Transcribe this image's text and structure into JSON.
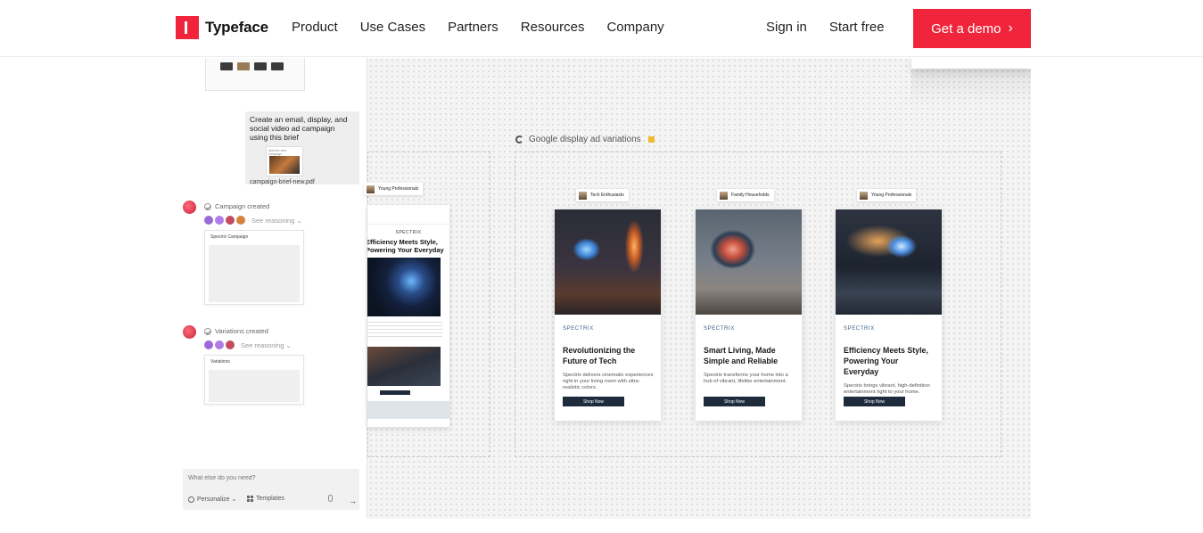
{
  "header": {
    "logo_text": "Typeface",
    "nav": [
      "Product",
      "Use Cases",
      "Partners",
      "Resources",
      "Company"
    ],
    "sign_in": "Sign in",
    "start_free": "Start free",
    "demo_label": "Get a demo",
    "demo_chevron": "›"
  },
  "chat": {
    "prompt": "Create an email, display, and social video ad campaign using this brief",
    "brief_card_title": "Spectrix new campaign",
    "attachment_name": "campaign-brief-new.pdf",
    "step1": {
      "status": "Campaign created",
      "reasoning": "See reasoning ⌄",
      "card_title": "Spectrix Campaign"
    },
    "step2": {
      "status": "Variations created",
      "reasoning": "See reasoning ⌄",
      "card_title": "Variations"
    },
    "input_placeholder": "What else do you need?",
    "personalize": "Personalize ⌄",
    "templates": "Templates",
    "send": "→"
  },
  "canvas": {
    "email_variant": {
      "persona": "Young Professionals",
      "brand": "SPECTRIX",
      "title": "Efficiency Meets Style, Powering Your Everyday"
    },
    "group_label": "Google display ad variations",
    "ads": [
      {
        "persona": "Tech Enthusiasts",
        "brand": "SPECTRIX",
        "title": "Revolutionizing the Future of Tech",
        "desc": "Spectrix delivers cinematic experiences right in your living room with ultra-realistic colors.",
        "cta": "Shop Now"
      },
      {
        "persona": "Family Households",
        "brand": "SPECTRIX",
        "title": "Smart Living, Made Simple and Reliable",
        "desc": "Spectrix transforms your home into a hub of vibrant, lifelike entertainment.",
        "cta": "Shop Now"
      },
      {
        "persona": "Young Professionals",
        "brand": "SPECTRIX",
        "title": "Efficiency Meets Style, Powering Your Everyday",
        "desc": "Spectrix brings vibrant, high-definition entertainment right to your home.",
        "cta": "Shop Now"
      }
    ]
  },
  "colors": {
    "brand": "#f0253b",
    "ad_brand": "#3a5c85",
    "cta_bg": "#1e2b3c"
  }
}
